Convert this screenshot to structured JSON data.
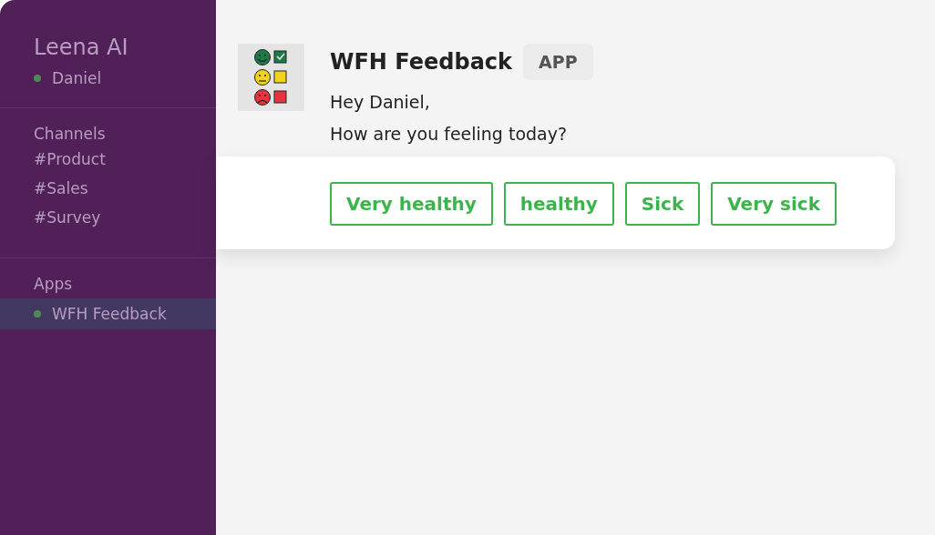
{
  "sidebar": {
    "workspace": "Leena AI",
    "user": {
      "name": "Daniel",
      "online": true
    },
    "channels": {
      "heading": "Channels",
      "items": [
        {
          "label": "#Product",
          "selected": false
        },
        {
          "label": "#Sales",
          "selected": false
        },
        {
          "label": "#Survey",
          "selected": false
        }
      ]
    },
    "apps": {
      "heading": "Apps",
      "items": [
        {
          "label": "WFH Feedback",
          "selected": true,
          "online": true
        }
      ]
    }
  },
  "message": {
    "sender": "WFH Feedback",
    "badge": "APP",
    "lines": [
      "Hey Daniel,",
      "How are you feeling today?"
    ],
    "options": [
      "Very healthy",
      "healthy",
      "Sick",
      "Very sick"
    ]
  }
}
